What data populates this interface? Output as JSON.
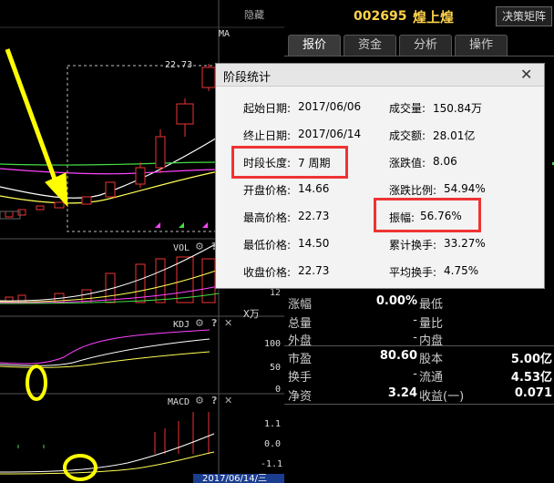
{
  "chart": {
    "hide_label": "隐藏",
    "ma_label": "MA",
    "peak_price": "22.73",
    "vol_title": "VOL",
    "vol_axis": [
      "12"
    ],
    "vol_unit": "X万",
    "kdj_title": "KDJ",
    "kdj_axis": [
      "100",
      "50",
      "0"
    ],
    "macd_title": "MACD",
    "macd_axis": [
      "1.1",
      "0.0",
      "-1.1"
    ],
    "date_label": "2017/06/14/三",
    "panel_buttons": [
      "gear-icon",
      "help-icon",
      "close-icon"
    ]
  },
  "quote": {
    "code": "002695",
    "name": "煌上煌",
    "decision_button": "决策矩阵",
    "tabs": [
      "报价",
      "资金",
      "分析",
      "操作"
    ],
    "rows": [
      {
        "label": "涨幅",
        "value": "0.00%",
        "label2": "最低",
        "value2": ""
      },
      {
        "label": "总量",
        "value": "-",
        "label2": "量比",
        "value2": ""
      },
      {
        "label": "外盘",
        "value": "-",
        "label2": "内盘",
        "value2": ""
      }
    ],
    "fund_rows": [
      {
        "label": "市盈",
        "value": "80.60",
        "label2": "股本",
        "value2": "5.00亿"
      },
      {
        "label": "换手",
        "value": "-",
        "label2": "流通",
        "value2": "4.53亿"
      },
      {
        "label": "净资",
        "value": "3.24",
        "label2": "收益(一)",
        "value2": "0.071"
      }
    ]
  },
  "dialog": {
    "title": "阶段统计",
    "left": [
      {
        "label": "起始日期:",
        "value": "2017/06/06"
      },
      {
        "label": "终止日期:",
        "value": "2017/06/14"
      },
      {
        "label": "时段长度:",
        "value": "7 周期"
      },
      {
        "label": "开盘价格:",
        "value": "14.66"
      },
      {
        "label": "最高价格:",
        "value": "22.73"
      },
      {
        "label": "最低价格:",
        "value": "14.50"
      },
      {
        "label": "收盘价格:",
        "value": "22.73"
      }
    ],
    "right": [
      {
        "label": "成交量:",
        "value": "150.84万"
      },
      {
        "label": "成交额:",
        "value": "28.01亿"
      },
      {
        "label": "涨跌值:",
        "value": "8.06"
      },
      {
        "label": "涨跌比例:",
        "value": "54.94%"
      },
      {
        "label": "振幅:",
        "value": "56.76%"
      },
      {
        "label": "累计换手:",
        "value": "33.27%"
      },
      {
        "label": "平均换手:",
        "value": "4.75%"
      }
    ]
  },
  "colors": {
    "up": "#e33333",
    "ma1": "#ffffff",
    "ma2": "#ffff55",
    "ma3": "#ff44ff",
    "ma4": "#44dd44",
    "highlight": "#e33333",
    "arrow": "#ffff00"
  }
}
